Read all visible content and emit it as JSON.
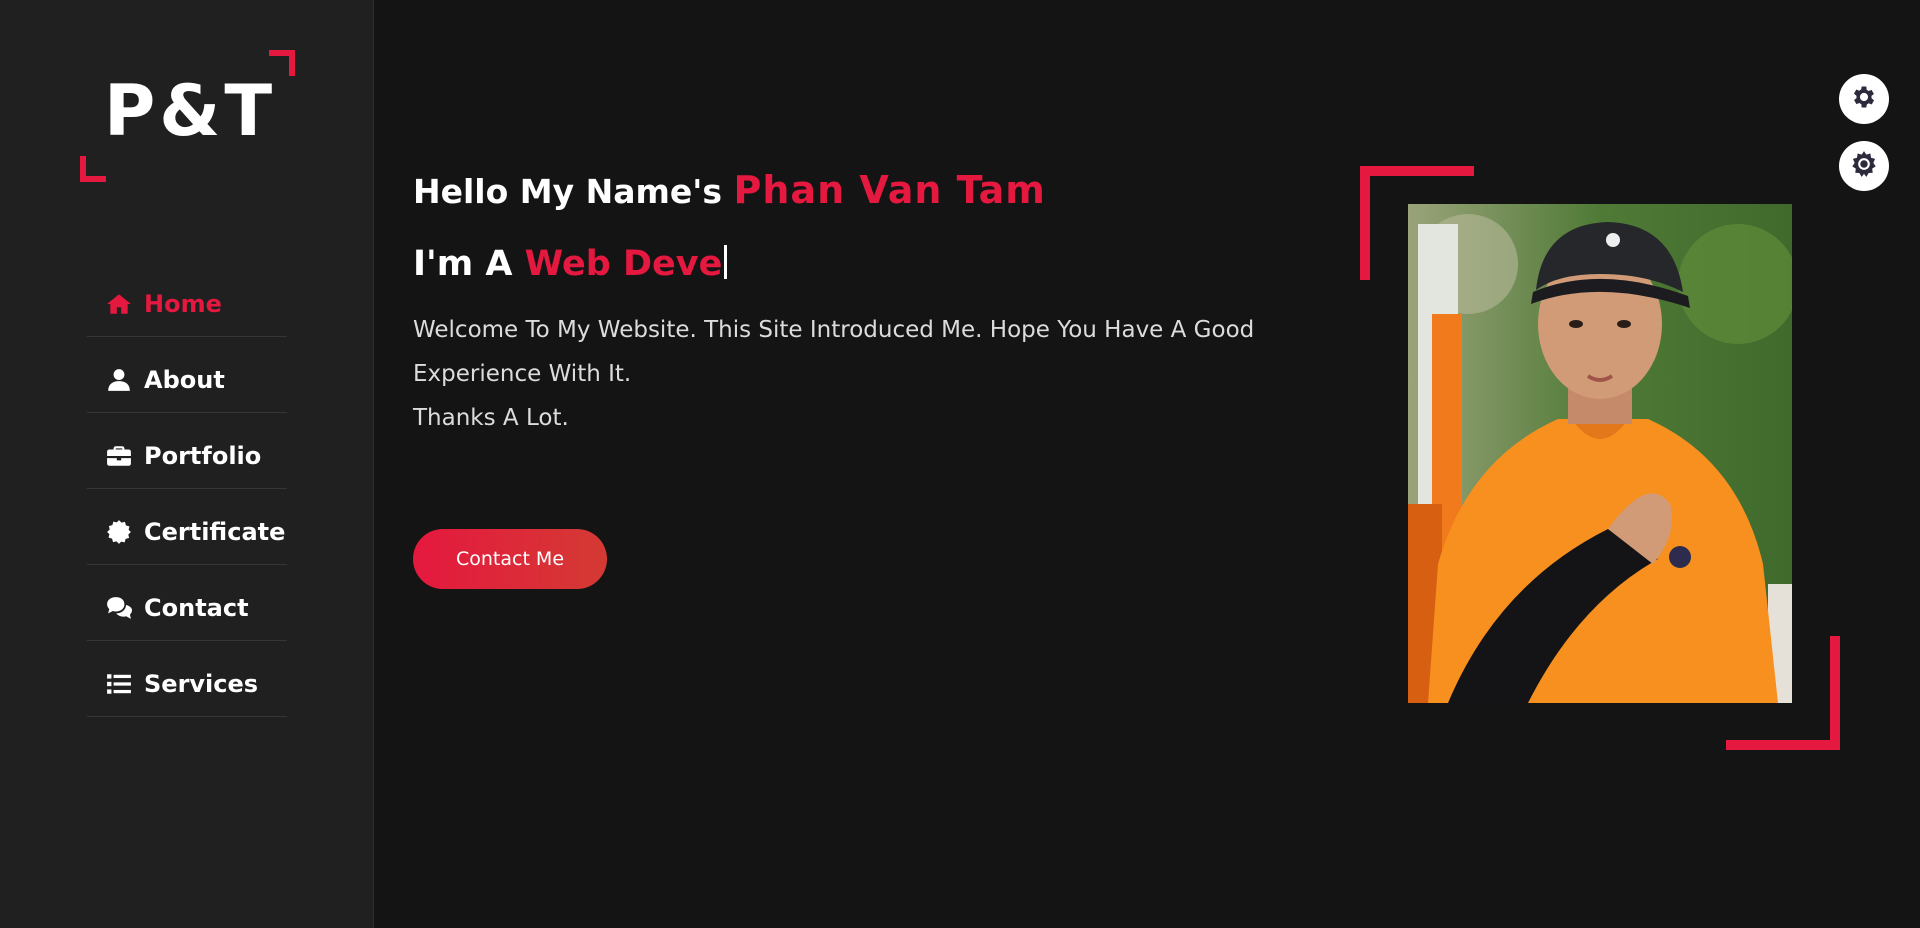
{
  "brand": {
    "logo_text": "P&T",
    "accent_color": "#e5183f"
  },
  "sidebar": {
    "items": [
      {
        "label": "Home",
        "icon": "home-icon",
        "active": true
      },
      {
        "label": "About",
        "icon": "user-icon",
        "active": false
      },
      {
        "label": "Portfolio",
        "icon": "briefcase-icon",
        "active": false
      },
      {
        "label": "Certificate",
        "icon": "certificate-icon",
        "active": false
      },
      {
        "label": "Contact",
        "icon": "comments-icon",
        "active": false
      },
      {
        "label": "Services",
        "icon": "list-icon",
        "active": false
      }
    ]
  },
  "hero": {
    "greeting_prefix": "Hello My Name's",
    "name": "Phan Van Tam",
    "role_prefix": "I'm A",
    "role_typed": "Web Deve",
    "intro_line1": "Welcome To My Website. This Site Introduced Me. Hope You Have A Good Experience With It.",
    "intro_line2": "Thanks A Lot.",
    "contact_button": "Contact Me"
  },
  "settings": {
    "gear1_icon": "gear-icon",
    "gear2_icon": "sun-gear-icon"
  }
}
